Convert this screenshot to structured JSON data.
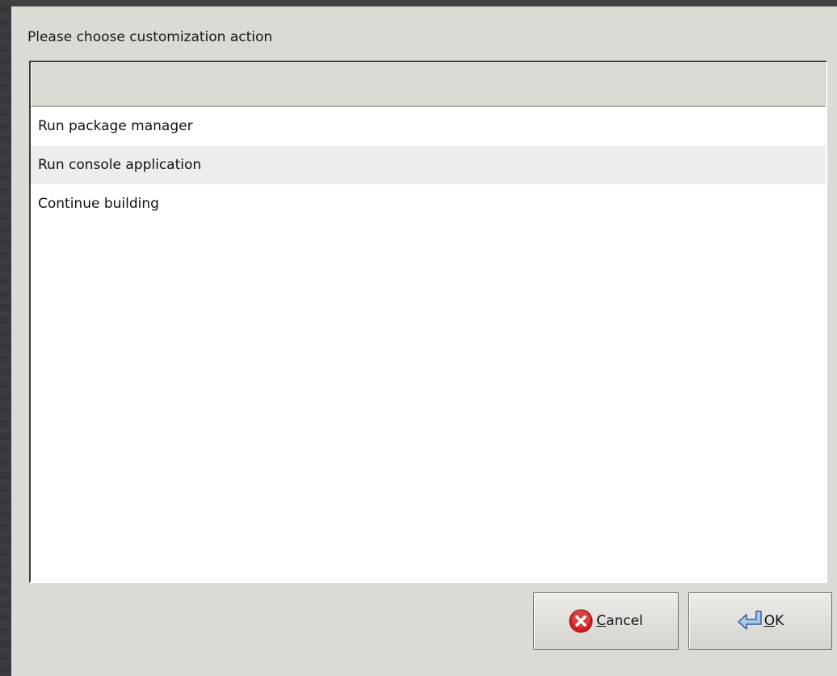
{
  "dialog": {
    "prompt": "Please choose customization action",
    "list_header": "",
    "items": [
      {
        "label": "Run package manager"
      },
      {
        "label": "Run console application"
      },
      {
        "label": "Continue building"
      }
    ],
    "buttons": {
      "cancel": {
        "mnemonic": "C",
        "rest": "ancel",
        "icon": "cancel-icon"
      },
      "ok": {
        "mnemonic": "O",
        "rest": "K",
        "icon": "return-arrow-icon"
      }
    }
  },
  "colors": {
    "dialog_bg": "#dcdad5",
    "desktop_bg": "#3a3d40",
    "list_bg": "#ffffff",
    "cancel_red": "#d32020",
    "ok_blue": "#4a7fc0"
  }
}
